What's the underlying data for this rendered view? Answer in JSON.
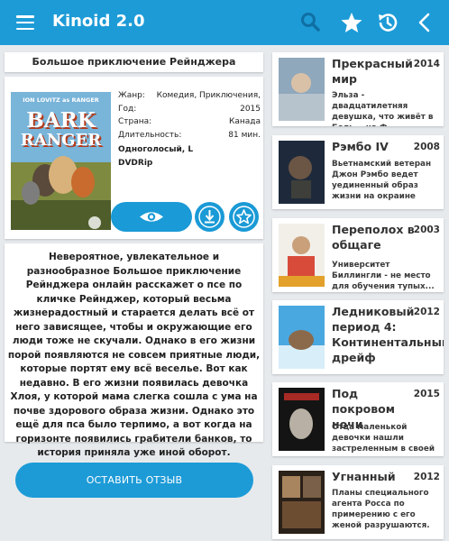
{
  "app": {
    "title": "Kinoid 2.0",
    "accent": "#1d9bd7",
    "icons": [
      "menu-icon",
      "search-icon",
      "star-icon",
      "history-icon",
      "back-icon"
    ]
  },
  "movie": {
    "title": "Большое приключение Рейнджера",
    "poster_text": {
      "top": "ION LOVITZ as RANGER",
      "main_1": "BARK",
      "main_2": "RANGER"
    },
    "details": [
      {
        "key": "Жанр:",
        "value": "Комедия, Приключения,"
      },
      {
        "key": "Год:",
        "value": "2015"
      },
      {
        "key": "Страна:",
        "value": "Канада"
      },
      {
        "key": "Длительность:",
        "value": "81 мин."
      }
    ],
    "translation": "Одноголосый, L",
    "quality": "DVDRip",
    "actions": [
      "eye-icon",
      "download-icon",
      "star-icon"
    ],
    "description": "Невероятное, увлекательное и разнообразное Большое приключение Рейнджера онлайн расскажет о псе по кличке Рейнджер, который весьма жизнерадостный и старается делать всё от него зависящее, чтобы и окружающие его люди тоже не скучали. Однако в его жизни порой появляются не совсем приятные люди, которые портят ему всё веселье. Вот как недавно. В его жизни появилась девочка Хлоя, у которой мама слегка сошла с ума на почве здорового образа жизни. Однако это ещё для пса было терпимо, а вот когда на горизонте появились грабители банков, то история приняла уже иной оборот."
  },
  "review_button": "ОСТАВИТЬ ОТЗЫВ",
  "related": [
    {
      "title": "Прекрасный мир",
      "year": "2014",
      "desc": "Эльза - двадцатилетняя девушка, что живёт в Бель... на Ф...",
      "thumb_text": "ELSA & FRED"
    },
    {
      "title": "Рэмбо IV",
      "year": "2008",
      "desc": "Вьетнамский ветеран Джон Рэмбо ведет уединенный образ жизни на окраине"
    },
    {
      "title": "Переполох в общаге",
      "year": "2003",
      "desc": "Университет Биллингли - не место для обучения тупых...",
      "thumb_text": "DORM DAZE"
    },
    {
      "title": "Ледниковый период 4: Континентальный дрейф",
      "year": "2012",
      "desc": ""
    },
    {
      "title": "Под покровом ночи",
      "year": "2015",
      "desc": "Отца маленькой девочки нашли застреленным в своей",
      "thumb_text": "NOCTURNA"
    },
    {
      "title": "Угнанный",
      "year": "2012",
      "desc": "Планы специального агента Росса по примерению с его женой разрушаются."
    }
  ]
}
